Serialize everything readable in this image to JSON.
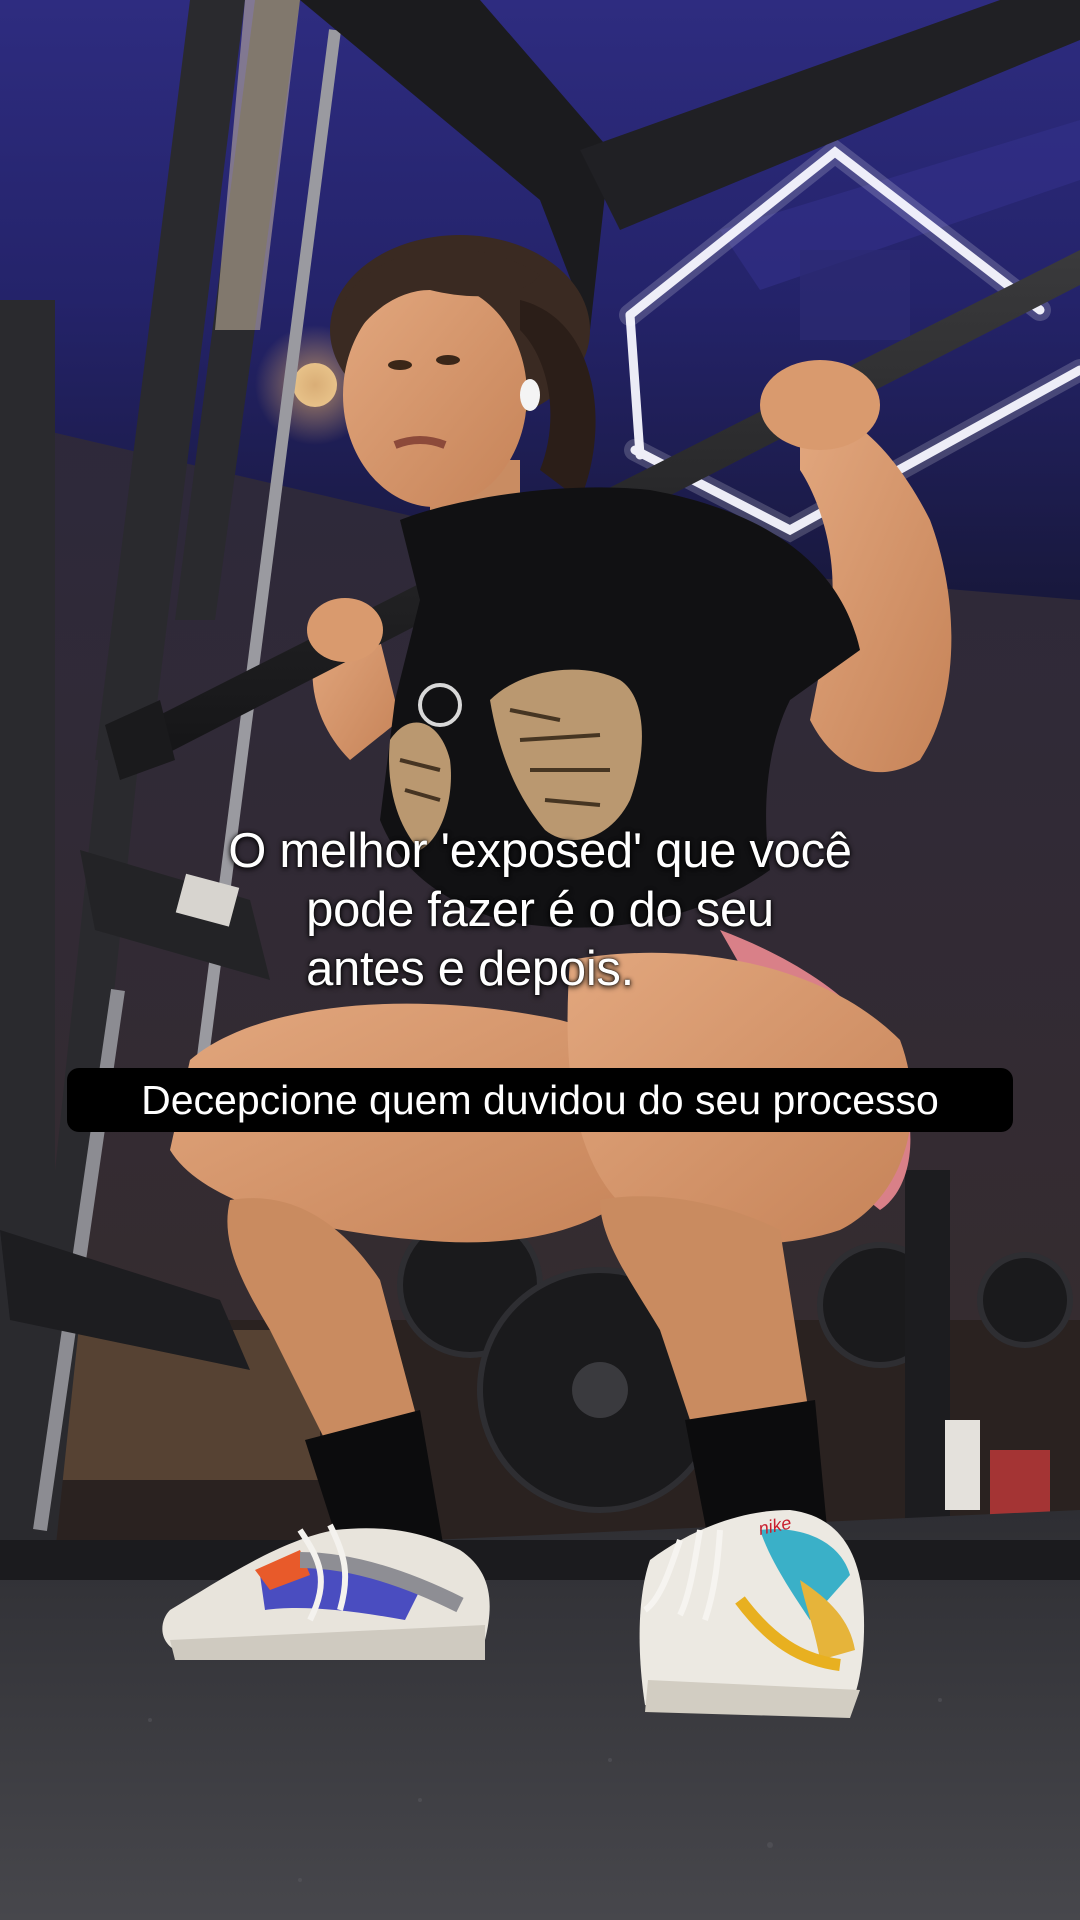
{
  "overlay": {
    "main_caption_lines": [
      "O melhor 'exposed' que você",
      "pode fazer é o do seu",
      "antes e depois."
    ],
    "sub_caption": "Decepcione quem duvidou do seu processo"
  },
  "photo": {
    "description_icon": "gym-squat-photo",
    "colors": {
      "ceiling": "#2b2a78",
      "floor": "#3a3a3e",
      "rack": "#2a2a2e",
      "led": "#f4f4ff",
      "shirt": "#111113",
      "shorts": "#d87a82",
      "skin": "#d89a72",
      "sock": "#0b0b0b",
      "sneaker": "#e9e6e0"
    }
  }
}
